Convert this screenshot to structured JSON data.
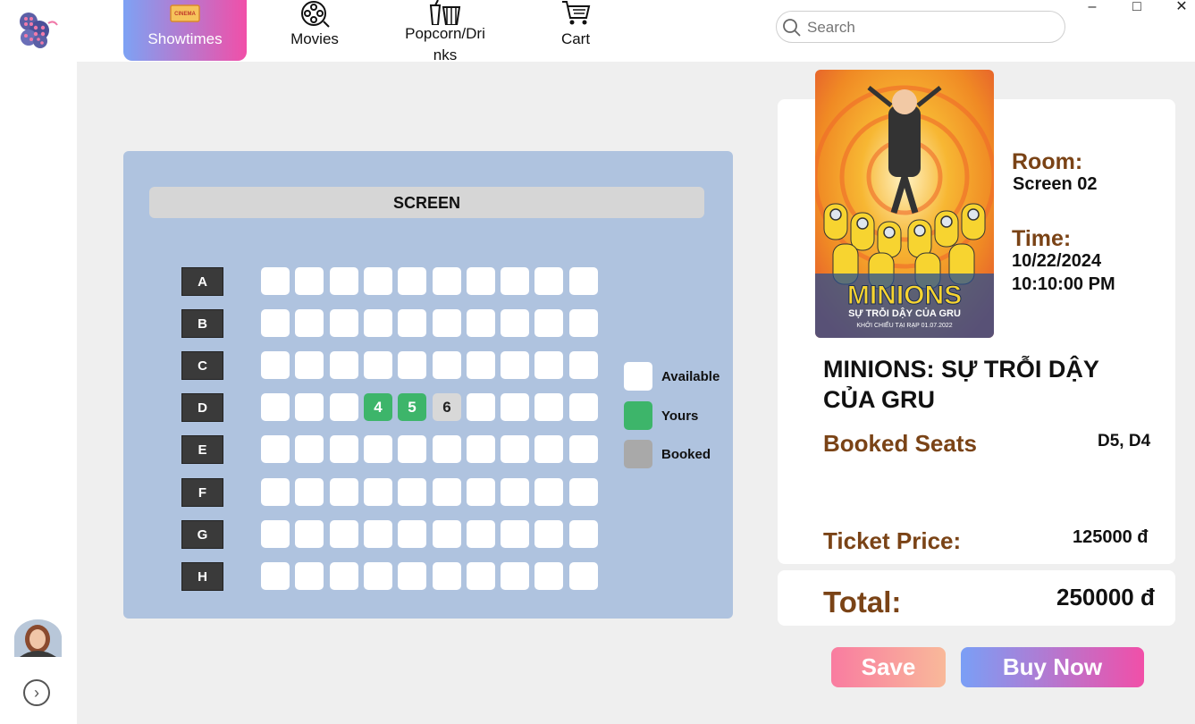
{
  "nav": {
    "tabs": [
      {
        "label": "Showtimes",
        "icon": "cinema-ticket-icon",
        "active": true
      },
      {
        "label": "Movies",
        "icon": "film-reel-icon"
      },
      {
        "label": "Popcorn/Dri\nnks",
        "icon": "popcorn-icon"
      },
      {
        "label": "Cart",
        "icon": "cart-icon"
      }
    ],
    "logo_icon": "film-reel-logo",
    "ticket_icon_text": "CINEMA"
  },
  "search": {
    "placeholder": "Search",
    "icon": "search-icon"
  },
  "window_controls": {
    "minimize": "–",
    "maximize": "□",
    "close": "✕"
  },
  "sidebar": {
    "expand_icon": "chevron-right-circle-icon",
    "expand_glyph": "›"
  },
  "seatmap": {
    "screen_label": "SCREEN",
    "rows": [
      "A",
      "B",
      "C",
      "D",
      "E",
      "F",
      "G",
      "H"
    ],
    "seats_per_row": 10,
    "special_seats": [
      {
        "row": "D",
        "index": 4,
        "label": "4",
        "status": "yours"
      },
      {
        "row": "D",
        "index": 5,
        "label": "5",
        "status": "yours"
      },
      {
        "row": "D",
        "index": 6,
        "label": "6",
        "status": "booked"
      }
    ],
    "legend": [
      {
        "label": "Available",
        "color": "#ffffff"
      },
      {
        "label": "Yours",
        "color": "#3db56a"
      },
      {
        "label": "Booked",
        "color": "#a9a9a9"
      }
    ]
  },
  "booking": {
    "room_label": "Room:",
    "room_value": "Screen 02",
    "time_label": "Time:",
    "date_value": "10/22/2024",
    "time_value": "10:10:00 PM",
    "movie_title": "MINIONS: SỰ TRỖI DẬY CỦA GRU",
    "booked_seats_label": "Booked Seats",
    "booked_seats_value": "D5, D4",
    "ticket_price_label": "Ticket Price:",
    "ticket_price_value": "125000 đ",
    "total_label": "Total:",
    "total_value": "250000 đ"
  },
  "poster": {
    "title": "MINIONS",
    "subtitle": "SỰ TRỖI DẬY CỦA GRU",
    "release_line": "KHỞI CHIẾU TẠI RẠP 01.07.2022"
  },
  "actions": {
    "save_label": "Save",
    "buy_label": "Buy Now"
  },
  "colors": {
    "accent_from": "#7da2f4",
    "accent_to": "#f14fa8",
    "label_brown": "#7a4316",
    "panel_blue": "#afc3df",
    "yours_green": "#3db56a"
  }
}
